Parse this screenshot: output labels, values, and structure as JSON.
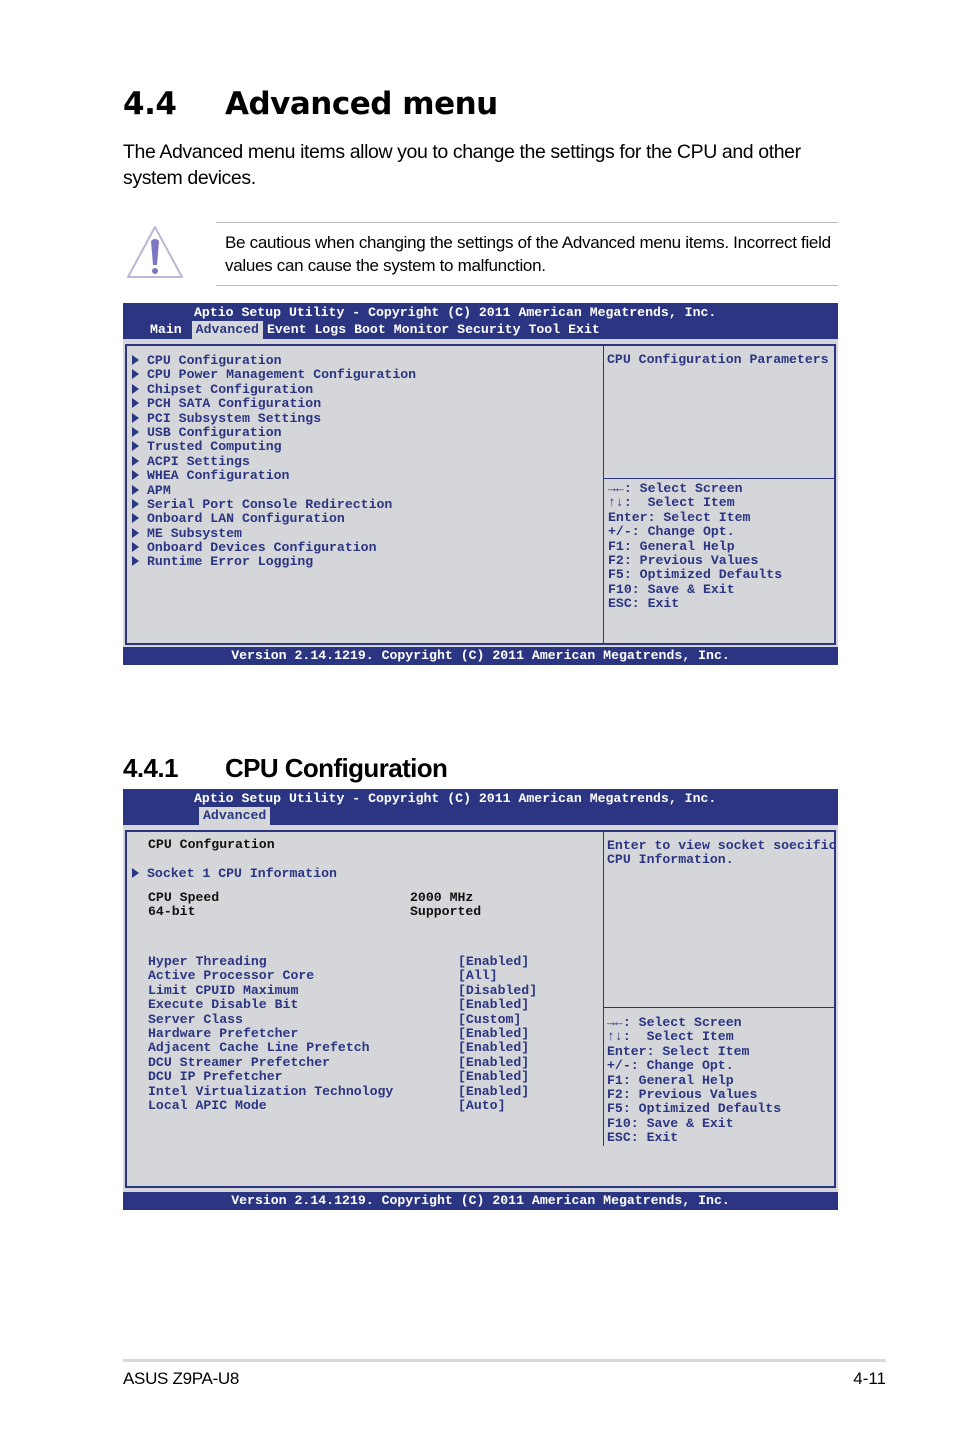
{
  "section": {
    "number": "4.4",
    "title": "Advanced menu",
    "intro": "The Advanced menu items allow you to change the settings for the CPU and other system devices."
  },
  "caution": {
    "icon": "warning-triangle-icon",
    "text": "Be cautious when changing the settings of the Advanced menu items. Incorrect field values can cause the system to malfunction."
  },
  "bios_advanced": {
    "header_title": "Aptio Setup Utility - Copyright (C) 2011 American Megatrends, Inc.",
    "tabs": [
      "Main",
      "Advanced",
      "Event Logs",
      "Boot",
      "Monitor",
      "Security",
      "Tool",
      "Exit"
    ],
    "active_tab": "Advanced",
    "menu_items": [
      "CPU Configuration",
      "CPU Power Management Configuration",
      "Chipset Configuration",
      "PCH SATA Configuration",
      "PCI Subsystem Settings",
      "USB Configuration",
      "Trusted Computing",
      "ACPI Settings",
      "WHEA Configuration",
      "APM",
      "Serial Port Console Redirection",
      "Onboard LAN Configuration",
      "ME Subsystem",
      "Onboard Devices Configuration",
      "Runtime Error Logging"
    ],
    "help_text": "CPU Configuration Parameters",
    "key_help": [
      "→←: Select Screen",
      "↑↓:  Select Item",
      "Enter: Select Item",
      "+/-: Change Opt.",
      "F1: General Help",
      "F2: Previous Values",
      "F5: Optimized Defaults",
      "F10: Save & Exit",
      "ESC: Exit"
    ],
    "footer": "Version 2.14.1219. Copyright (C) 2011 American Megatrends, Inc."
  },
  "subsection": {
    "number": "4.4.1",
    "title": "CPU Configuration"
  },
  "bios_cpu": {
    "header_title": "Aptio Setup Utility - Copyright (C) 2011 American Megatrends, Inc.",
    "active_tab": "Advanced",
    "page_heading": "CPU Confguration",
    "submenu": "Socket 1 CPU Information",
    "info": [
      {
        "label": "CPU Speed",
        "value": "2000 MHz"
      },
      {
        "label": "64-bit",
        "value": "Supported"
      }
    ],
    "settings": [
      {
        "label": "Hyper Threading",
        "value": "[Enabled]"
      },
      {
        "label": "Active Processor Core",
        "value": "[All]"
      },
      {
        "label": "Limit CPUID Maximum",
        "value": "[Disabled]"
      },
      {
        "label": "Execute Disable Bit",
        "value": "[Enabled]"
      },
      {
        "label": "Server Class",
        "value": "[Custom]"
      },
      {
        "label": "Hardware Prefetcher",
        "value": "[Enabled]"
      },
      {
        "label": "Adjacent Cache Line Prefetch",
        "value": "[Enabled]"
      },
      {
        "label": "DCU Streamer Prefetcher",
        "value": "[Enabled]"
      },
      {
        "label": "DCU IP Prefetcher",
        "value": "[Enabled]"
      },
      {
        "label": "Intel Virtualization Technology",
        "value": "[Enabled]"
      },
      {
        "label": "Local APIC Mode",
        "value": "[Auto]"
      }
    ],
    "help_text": [
      "Enter to view socket soecific",
      "CPU Information."
    ],
    "key_help": [
      "→←: Select Screen",
      "↑↓:  Select Item",
      "Enter: Select Item",
      "+/-: Change Opt.",
      "F1: General Help",
      "F2: Previous Values",
      "F5: Optimized Defaults",
      "F10: Save & Exit",
      "ESC: Exit"
    ],
    "footer": "Version 2.14.1219. Copyright (C) 2011 American Megatrends, Inc."
  },
  "page_footer": {
    "product": "ASUS Z9PA-U8",
    "page": "4-11"
  },
  "colors": {
    "bios_blue": "#2b3582",
    "bios_gray": "#d5d6d9",
    "warning_icon": "#7b78c2"
  }
}
